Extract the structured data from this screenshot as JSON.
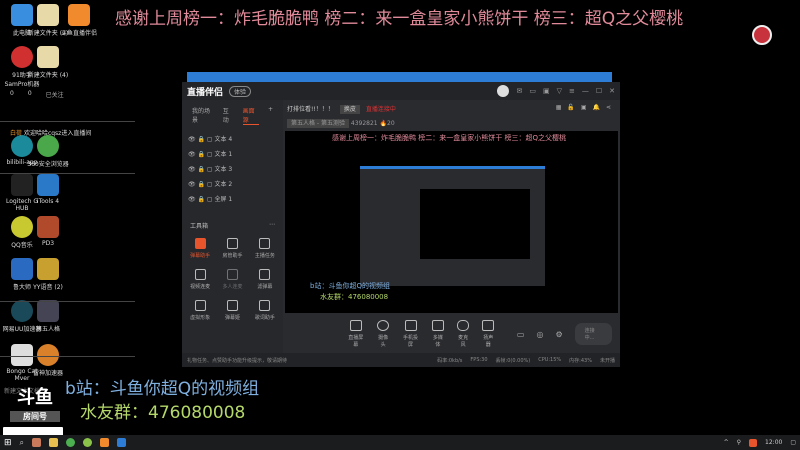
{
  "banner": "感谢上周榜一：炸毛脆脆鸭 榜二：来一盒皇家小熊饼干 榜三：超Q之父樱桃",
  "desktop": {
    "icons": [
      "此电脑",
      "新建文件夹 (2)",
      "斗鱼直播伴侣",
      "91助手 SamPro机器",
      "新建文件夹 (4)",
      "bilibili-app",
      "360安全浏览器",
      "Logitech G HUB",
      "iTools 4",
      "QQ音乐",
      "PD3",
      "鲁大师",
      "YY语音 (2)",
      "网易UU加速器",
      "第五人格",
      "Bongo Cat Mver",
      "雷神加速器",
      "新建文本文档"
    ],
    "danmu_user": "白荷",
    "danmu_text": "欢迎哈哈cqsz进入直播间",
    "followed": "已关注",
    "counts": [
      "0",
      "0"
    ]
  },
  "app": {
    "logo": "直播伴侣",
    "version": "体验",
    "tabs": [
      "我的场景",
      "互动",
      "画面源"
    ],
    "layers": [
      "文本 4",
      "文本 1",
      "文本 3",
      "文本 2",
      "全屏 1"
    ],
    "tools_title": "工具箱",
    "tools": [
      "弹幕助手",
      "房管助手",
      "主播任务",
      "视频连麦",
      "多人连麦",
      "滤弹幕",
      "虚拟形象",
      "弹幕姬",
      "歌词助手",
      "PK",
      "下载",
      "更多"
    ],
    "room_title": "打排位看!!！！！",
    "category_tag": "换皮",
    "live_status": "直播连接中",
    "game": "第五人格 - 第五测验",
    "room_id": "4392821",
    "fans": "20",
    "preview_bili": "b站：斗鱼你超Q的视频组",
    "preview_qq": "水友群：476080008",
    "controls": [
      "直播屏幕",
      "摄像头",
      "手机投屏",
      "多媒体",
      "麦克风",
      "扬声器"
    ],
    "start_button": "连接中...",
    "status_tip": "礼物任务、点赞助手功能升级提示，敬请期待",
    "stats": [
      "码率:0kb/s",
      "FPS:30",
      "丢帧:0(0.00%)",
      "CPU:15%",
      "内存:43%",
      "未开播"
    ]
  },
  "overlay": {
    "bili": "b站：斗鱼你超Q的视频组",
    "qq": "水友群：476080008",
    "douyu": "斗鱼",
    "douyu_sub": "房间号"
  },
  "taskbar": {
    "time": "12:00"
  }
}
